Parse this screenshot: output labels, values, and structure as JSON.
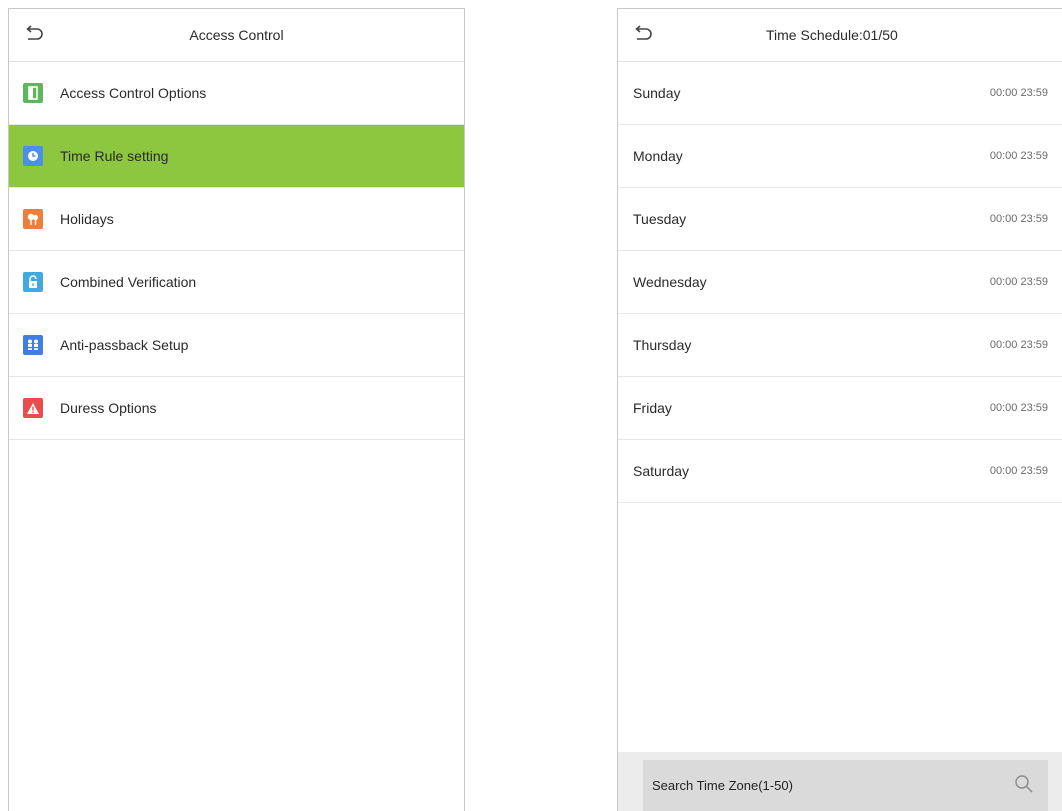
{
  "left_screen": {
    "header": {
      "back_icon": "back-arrow-icon",
      "title": "Access Control"
    },
    "menu": [
      {
        "label": "Access Control Options",
        "icon": "door-icon",
        "icon_color": "#5cb85c"
      },
      {
        "label": "Time Rule setting",
        "icon": "clock-icon",
        "icon_color": "#4a8fe8",
        "active": true
      },
      {
        "label": "Holidays",
        "icon": "holiday-icon",
        "icon_color": "#ef7d3c"
      },
      {
        "label": "Combined Verification",
        "icon": "lock-icon",
        "icon_color": "#3fa9e0"
      },
      {
        "label": "Anti-passback Setup",
        "icon": "people-icon",
        "icon_color": "#3f7fe0"
      },
      {
        "label": "Duress Options",
        "icon": "warning-icon",
        "icon_color": "#e84c4c"
      }
    ],
    "active_color": "#8dc63f"
  },
  "right_screen": {
    "header": {
      "back_icon": "back-arrow-icon",
      "title": "Time Schedule:01/50"
    },
    "days": [
      {
        "name": "Sunday",
        "time": "00:00 23:59"
      },
      {
        "name": "Monday",
        "time": "00:00 23:59"
      },
      {
        "name": "Tuesday",
        "time": "00:00 23:59"
      },
      {
        "name": "Wednesday",
        "time": "00:00 23:59"
      },
      {
        "name": "Thursday",
        "time": "00:00 23:59"
      },
      {
        "name": "Friday",
        "time": "00:00 23:59"
      },
      {
        "name": "Saturday",
        "time": "00:00 23:59"
      }
    ],
    "search": {
      "label": "Search Time Zone(1-50)",
      "icon": "search-icon"
    }
  }
}
